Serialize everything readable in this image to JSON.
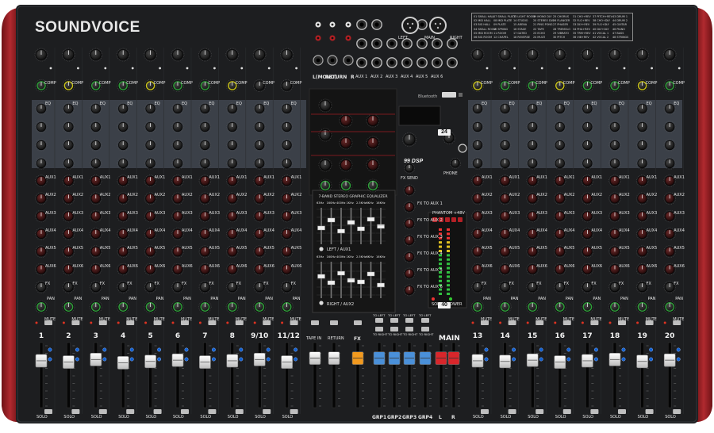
{
  "brand": "SOUNDVOICE",
  "colors": {
    "body": "#1e1f21",
    "side_panel": "#9c1f24",
    "knob_green": "#2f9e3a",
    "knob_yellow": "#c8c21c",
    "fader_orange": "#f29a1f",
    "fader_blue": "#4a90d9",
    "fader_red": "#d9262b"
  },
  "channel_count": 20,
  "channel_labels": [
    "1",
    "2",
    "3",
    "4",
    "5",
    "6",
    "7",
    "8",
    "9/10",
    "11/12",
    "13",
    "14",
    "15",
    "16",
    "17",
    "18",
    "19",
    "20"
  ],
  "row_labels": {
    "aux": [
      "AUX1",
      "AUX2",
      "AUX3",
      "AUX4",
      "AUX5",
      "AUX6"
    ],
    "fx": "FX",
    "pan": "PAN",
    "mute": "MUTE",
    "solo": "SOLO",
    "eq": "EQ",
    "comp": "COMP"
  },
  "center": {
    "bluetooth": "Bluetooth",
    "return": "RETURN",
    "left": "LEFT",
    "main": "MAIN",
    "right": "RIGHT",
    "eq_title": "7-BAND STEREO GRAPHIC EQUALIZER",
    "eq_freqs": [
      "63Hz",
      "160Hz",
      "400Hz",
      "1KHz",
      "2.5KHz",
      "6KHz",
      "16KHz"
    ],
    "left_aux1": "LEFT / AUX1",
    "right_aux2": "RIGHT / AUX2",
    "l_mono": "L(MONO)",
    "r": "R",
    "aux_sends": [
      "AUX 1",
      "AUX 2",
      "AUX 3",
      "AUX 4",
      "AUX 5",
      "AUX 6"
    ],
    "phones": "PHONE",
    "fx_send": "FX SEND",
    "fx_to_aux": [
      "FX TO AUX 1",
      "FX TO AUX 2",
      "FX TO AUX 3",
      "FX TO AUX 4",
      "FX TO AUX 5",
      "FX TO AUX 6"
    ],
    "phantom": "PHANTOM +48V",
    "solo": "SOLO",
    "power": "POWER",
    "dsp_brand": "99",
    "dsp_suffix": "DSP",
    "badge_top": "24",
    "badge_bottom": "40",
    "badge_bits": "BIT",
    "tape_in": "TAPE IN",
    "return_btn": "RETURN",
    "fx_btn": "FX",
    "to_left": "TO LEFT",
    "to_right": "TO RIGHT",
    "groups": [
      "GRP1",
      "GRP2",
      "GRP3",
      "GRP4"
    ],
    "main_lr": [
      "L",
      "R"
    ],
    "main_label": "MAIN"
  },
  "fx_presets": [
    "01 SMALL HALL",
    "02 MID HALL",
    "03 BIG HALL",
    "04 SMALL ROOM",
    "05 MID ROOM",
    "06 BIG ROOM",
    "07 SMALL PLATE",
    "08 MID PLATE",
    "09 PLATE",
    "10 SPRING",
    "11 ROOM",
    "12 CHAPEL",
    "13 LIGHT ROOM",
    "14 STUDIO",
    "15 ARENA",
    "16 STAGE",
    "17 GATED",
    "18 REVERSE",
    "19 MONO DLY",
    "20 STEREO DLY",
    "21 PING PONG",
    "22 TAPE",
    "23 ECHO",
    "24 MULTI",
    "25 CHORUS",
    "26 FLANGER",
    "27 PHASER",
    "28 TREMOLO",
    "29 VIBRATO",
    "30 PITCH",
    "31 CHO+REV",
    "32 FLG+REV",
    "33 DLY+REV",
    "34 PHA+REV",
    "35 TRM+REV",
    "36 VIB+REV",
    "37 PITCH+REV",
    "38 CHO+DLY",
    "39 FLG+DLY",
    "40 DLY+DLY",
    "41 VOCAL 1",
    "42 VOCAL 2",
    "43 DRUM 1",
    "44 DRUM 2",
    "45 GUITAR",
    "46 PIANO",
    "47 BASS",
    "48 STRINGS"
  ],
  "fx_preset_count": 99,
  "fader_levels": {
    "channels": [
      0.72,
      0.7,
      0.74,
      0.69,
      0.71,
      0.73,
      0.7,
      0.72,
      0.74,
      0.7,
      0.72,
      0.71,
      0.73,
      0.7,
      0.72,
      0.74,
      0.71,
      0.73
    ],
    "center": [
      0.76,
      0.76,
      0.76,
      0.76,
      0.76,
      0.76,
      0.76,
      0.76,
      0.76,
      0.76
    ]
  }
}
